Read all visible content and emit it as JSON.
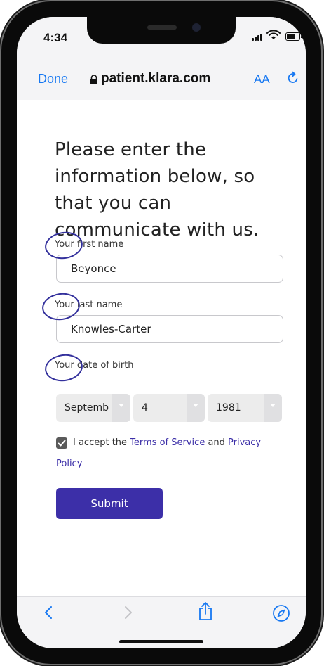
{
  "status_bar": {
    "time": "4:34",
    "icons": [
      "signal-icon",
      "wifi-icon",
      "battery-icon"
    ]
  },
  "browser": {
    "done_label": "Done",
    "url": "patient.klara.com",
    "text_size_label": "AA",
    "icons": [
      "lock-icon",
      "reload-icon"
    ]
  },
  "form": {
    "heading": "Please enter the information below, so that you can communicate with us.",
    "first_name_label": "Your first name",
    "first_name_value": "Beyonce",
    "last_name_label": "Your last name",
    "last_name_value": "Knowles-Carter",
    "dob_label": "Your date of birth",
    "dob_month": "Septemb",
    "dob_day": "4",
    "dob_year": "1981",
    "consent_prefix": "I accept the ",
    "terms_link": "Terms of Service",
    "consent_and": " and ",
    "privacy_link": "Privacy Policy",
    "submit_label": "Submit"
  },
  "toolbar": {
    "icons": [
      "back-icon",
      "forward-icon",
      "share-icon",
      "compass-icon"
    ]
  },
  "colors": {
    "accent": "#3c2fa8",
    "ios_blue": "#1778f2",
    "annotation": "#33309c"
  }
}
